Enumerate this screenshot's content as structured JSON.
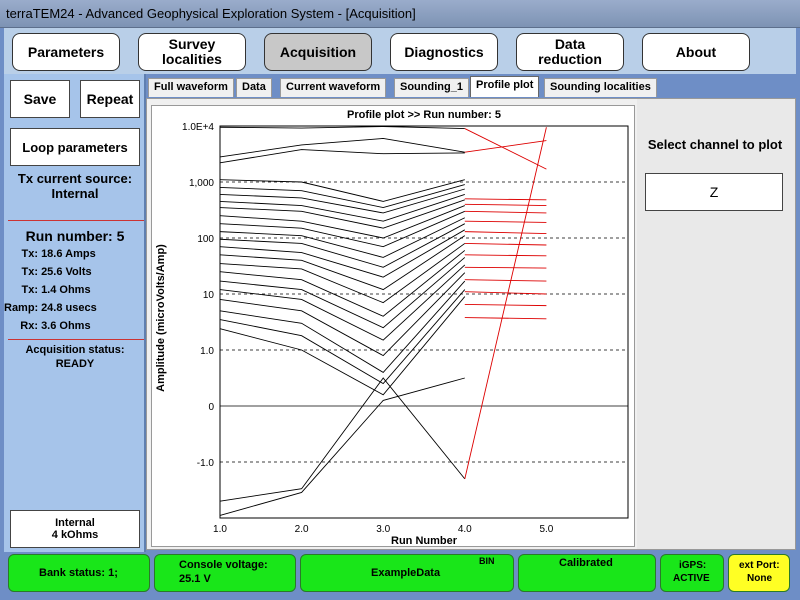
{
  "window": {
    "title": "terraTEM24 - Advanced Geophysical Exploration System - [Acquisition]"
  },
  "topnav": [
    {
      "label": "Parameters"
    },
    {
      "label": "Survey\nlocalities"
    },
    {
      "label": "Acquisition"
    },
    {
      "label": "Diagnostics"
    },
    {
      "label": "Data\nreduction"
    },
    {
      "label": "About"
    }
  ],
  "left": {
    "save_label": "Save",
    "repeat_label": "Repeat",
    "loop_label": "Loop parameters",
    "tx_source_label": "Tx current source:",
    "tx_source_value": "Internal",
    "run_number": "Run number: 5",
    "readings": [
      {
        "k": "Tx:",
        "v": "18.6 Amps"
      },
      {
        "k": "Tx:",
        "v": "25.6 Volts"
      },
      {
        "k": "Tx:",
        "v": "1.4 Ohms"
      },
      {
        "k": "Ramp:",
        "v": "24.8 usecs"
      },
      {
        "k": "Rx:",
        "v": "3.6 Ohms"
      }
    ],
    "acq_status_label": "Acquisition status:",
    "acq_status_value": "READY",
    "internal_box_line1": "Internal",
    "internal_box_line2": "4 kOhms"
  },
  "tabs": [
    {
      "label": "Full waveform"
    },
    {
      "label": "Data"
    },
    {
      "label": "Current waveform"
    },
    {
      "label": "Sounding_1"
    },
    {
      "label": "Profile plot"
    },
    {
      "label": "Sounding localities"
    }
  ],
  "right": {
    "select_label": "Select channel to plot",
    "channel_value": "Z"
  },
  "chart_data": {
    "type": "line",
    "title": "Profile plot >> Run number: 5",
    "xlabel": "Run Number",
    "ylabel": "Amplitude (microVolts/Amp)",
    "x": [
      1,
      2,
      3,
      4,
      5
    ],
    "x_ticks": [
      "1.0",
      "2.0",
      "3.0",
      "4.0",
      "5.0"
    ],
    "y_scale": "symlog",
    "y_ticks": [
      "1.0E+4",
      "1,000",
      "100",
      "10",
      "1.0",
      "0",
      "-1.0"
    ],
    "y_tick_values": [
      10000,
      1000,
      100,
      10,
      1,
      0,
      -1
    ],
    "grid": "dashed-horizontal",
    "series_colors": {
      "previous": "#000000",
      "current": "#dd0000"
    },
    "series": [
      {
        "values": [
          9500,
          9200,
          9800,
          9000
        ]
      },
      {
        "values": [
          2800,
          4600,
          6000,
          3400
        ]
      },
      {
        "values": [
          2200,
          3800,
          3200,
          3300
        ]
      },
      {
        "values": [
          1100,
          1000,
          450,
          1100
        ]
      },
      {
        "values": [
          800,
          700,
          350,
          900
        ]
      },
      {
        "values": [
          600,
          520,
          280,
          750
        ]
      },
      {
        "values": [
          450,
          380,
          200,
          600
        ]
      },
      {
        "values": [
          350,
          300,
          150,
          480
        ]
      },
      {
        "values": [
          250,
          200,
          100,
          380
        ]
      },
      {
        "values": [
          180,
          150,
          70,
          300
        ]
      },
      {
        "values": [
          130,
          110,
          45,
          230
        ]
      },
      {
        "values": [
          95,
          80,
          30,
          180
        ]
      },
      {
        "values": [
          70,
          55,
          20,
          140
        ]
      },
      {
        "values": [
          50,
          40,
          12,
          110
        ]
      },
      {
        "values": [
          35,
          28,
          7,
          80
        ]
      },
      {
        "values": [
          25,
          18,
          4,
          60
        ]
      },
      {
        "values": [
          17,
          12,
          2.5,
          45
        ]
      },
      {
        "values": [
          12,
          8,
          1.5,
          33
        ]
      },
      {
        "values": [
          8,
          5,
          0.9,
          24
        ]
      },
      {
        "values": [
          5,
          3,
          0.6,
          17
        ]
      },
      {
        "values": [
          3.5,
          1.8,
          0.4,
          12
        ]
      },
      {
        "values": [
          2.4,
          1.0,
          0.2,
          9
        ]
      },
      {
        "values": [
          -5,
          -3,
          0.5,
          -2
        ]
      },
      {
        "values": [
          -9,
          -3.5,
          0.1,
          0.5
        ]
      },
      {
        "name": "Run 5",
        "current": true,
        "values": [
          null,
          null,
          null,
          -2,
          9500
        ]
      },
      {
        "current": true,
        "values": [
          null,
          null,
          null,
          3400,
          5500
        ]
      },
      {
        "current": true,
        "values": [
          null,
          null,
          null,
          9000,
          1700
        ]
      },
      {
        "current": true,
        "values": [
          null,
          null,
          null,
          500,
          480
        ]
      },
      {
        "current": true,
        "values": [
          null,
          null,
          null,
          400,
          380
        ]
      },
      {
        "current": true,
        "values": [
          null,
          null,
          null,
          300,
          280
        ]
      },
      {
        "current": true,
        "values": [
          null,
          null,
          null,
          200,
          190
        ]
      },
      {
        "current": true,
        "values": [
          null,
          null,
          null,
          130,
          120
        ]
      },
      {
        "current": true,
        "values": [
          null,
          null,
          null,
          80,
          75
        ]
      },
      {
        "current": true,
        "values": [
          null,
          null,
          null,
          50,
          48
        ]
      },
      {
        "current": true,
        "values": [
          null,
          null,
          null,
          30,
          29
        ]
      },
      {
        "current": true,
        "values": [
          null,
          null,
          null,
          18,
          17
        ]
      },
      {
        "current": true,
        "values": [
          null,
          null,
          null,
          11,
          10
        ]
      },
      {
        "current": true,
        "values": [
          null,
          null,
          null,
          6.5,
          6.2
        ]
      },
      {
        "current": true,
        "values": [
          null,
          null,
          null,
          3.8,
          3.6
        ]
      }
    ]
  },
  "status": {
    "bank": "Bank status: 1;",
    "console_label": "Console voltage:",
    "console_value": "25.1 V",
    "data_name": "ExampleData",
    "data_fmt": "BIN",
    "calibrated": "Calibrated",
    "igps_label": "iGPS:",
    "igps_value": "ACTIVE",
    "ext_label": "ext Port:",
    "ext_value": "None"
  }
}
